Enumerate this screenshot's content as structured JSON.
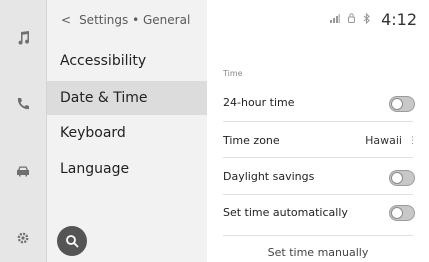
{
  "rail": {
    "icons": [
      "music-note-icon",
      "phone-icon",
      "car-icon",
      "gear-icon"
    ]
  },
  "menu": {
    "breadcrumb": "Settings • General",
    "items": [
      {
        "label": "Accessibility"
      },
      {
        "label": "Date & Time",
        "active": true
      },
      {
        "label": "Keyboard"
      },
      {
        "label": "Language"
      }
    ],
    "search_icon": "search-icon"
  },
  "status": {
    "icons": [
      "signal-icon",
      "lock-icon",
      "bluetooth-icon"
    ],
    "time": "4:12"
  },
  "panel": {
    "section_label": "Time",
    "rows": [
      {
        "label": "24-hour time",
        "control": "toggle",
        "on": false
      },
      {
        "label": "Time zone",
        "control": "value",
        "value": "Hawaii"
      },
      {
        "label": "Daylight savings",
        "control": "toggle",
        "on": false
      },
      {
        "label": "Set time automatically",
        "control": "toggle",
        "on": false
      }
    ],
    "manual_label": "Set time manually"
  }
}
